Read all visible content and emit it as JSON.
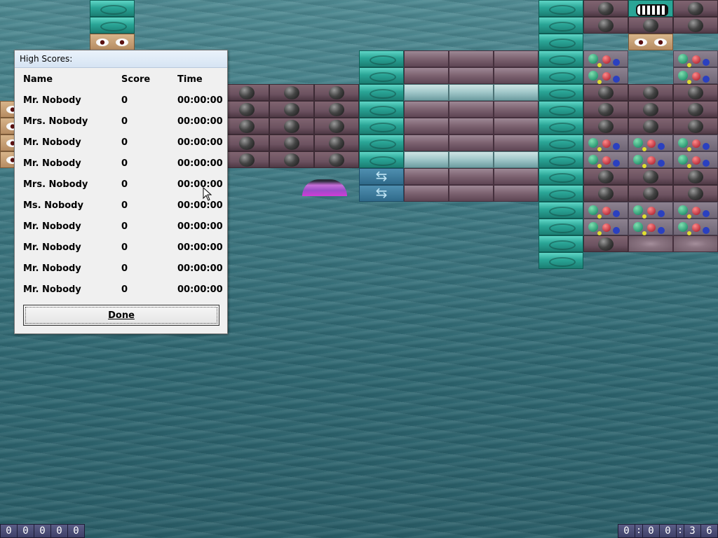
{
  "dialog": {
    "title": "High Scores:",
    "columns": {
      "name": "Name",
      "score": "Score",
      "time": "Time"
    },
    "rows": [
      {
        "name": "Mr. Nobody",
        "score": "0",
        "time": "00:00:00"
      },
      {
        "name": "Mrs. Nobody",
        "score": "0",
        "time": "00:00:00"
      },
      {
        "name": "Mr. Nobody",
        "score": "0",
        "time": "00:00:00"
      },
      {
        "name": "Mr. Nobody",
        "score": "0",
        "time": "00:00:00"
      },
      {
        "name": "Mrs. Nobody",
        "score": "0",
        "time": "00:00:00"
      },
      {
        "name": "Ms. Nobody",
        "score": "0",
        "time": "00:00:00"
      },
      {
        "name": "Mr. Nobody",
        "score": "0",
        "time": "00:00:00"
      },
      {
        "name": "Mr. Nobody",
        "score": "0",
        "time": "00:00:00"
      },
      {
        "name": "Mr. Nobody",
        "score": "0",
        "time": "00:00:00"
      },
      {
        "name": "Mr. Nobody",
        "score": "0",
        "time": "00:00:00"
      }
    ],
    "done_label": "Done"
  },
  "score_counter": [
    "0",
    "0",
    "0",
    "0",
    "0"
  ],
  "timer": {
    "digits": [
      "0",
      "0",
      "0",
      "3",
      "6"
    ],
    "separator": ":"
  },
  "colors": {
    "water": "#3f7a84",
    "brick_teal": "#2aa596",
    "brick_pink": "#7c6270",
    "brick_light": "#9fc6c8",
    "counter_bg": "#4a4c75",
    "paddle": "#c56fd8",
    "dialog_bg": "#f0f0f0"
  },
  "icons": {
    "bricks": [
      "teal-swirl-brick",
      "mauve-brick",
      "light-cyan-brick",
      "black-ball-brick",
      "gem-brick",
      "eyes-brick",
      "mouth-brick",
      "arrow-brick",
      "ripple-brick"
    ],
    "paddle": "paddle-icon",
    "cursor": "mouse-cursor-icon"
  }
}
